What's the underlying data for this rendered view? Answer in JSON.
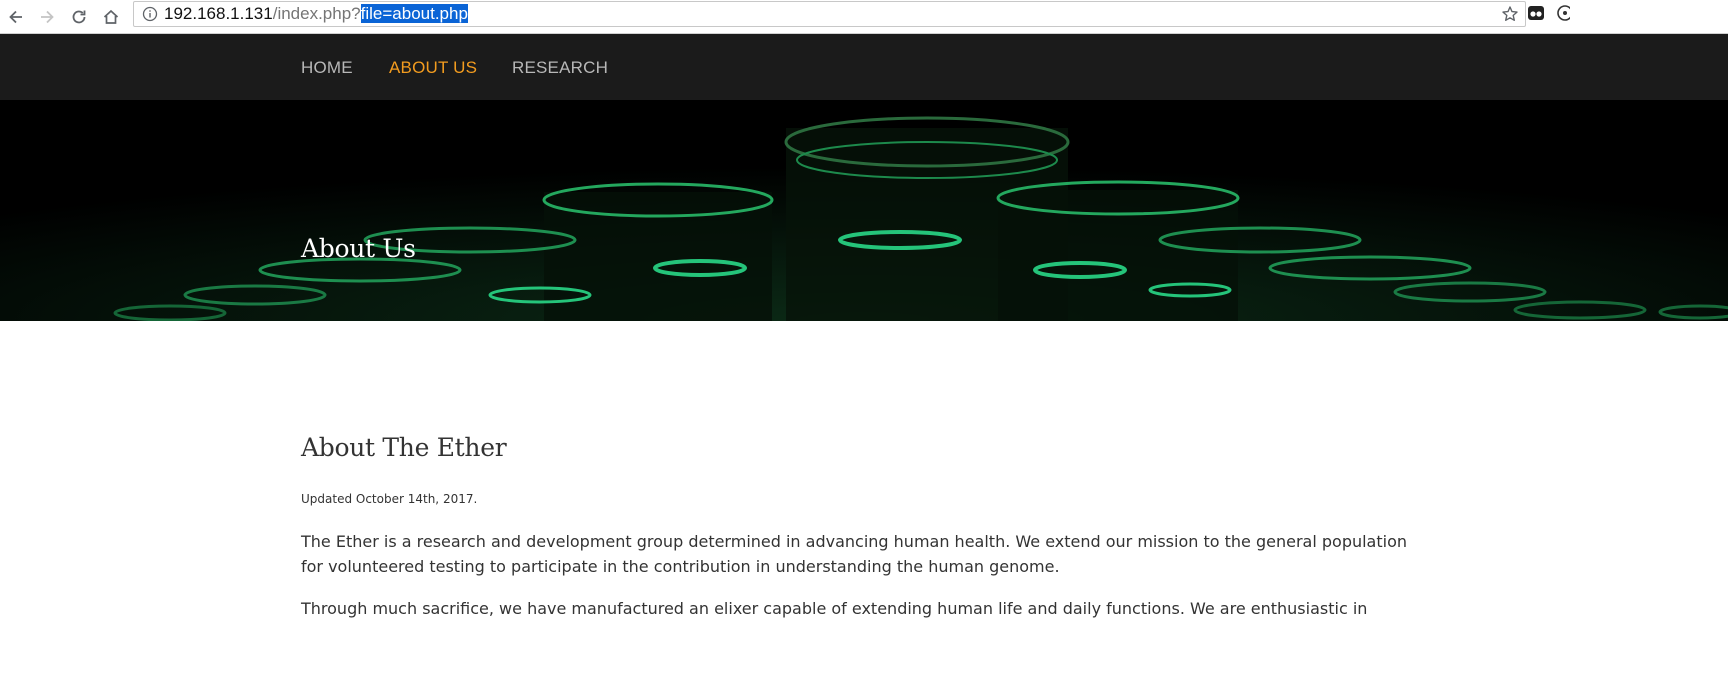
{
  "browser": {
    "url_host": "192.168.1.131",
    "url_path": "/index.php?",
    "url_query_selected": "file=about.php"
  },
  "nav": {
    "items": [
      {
        "label": "HOME"
      },
      {
        "label": "ABOUT US"
      },
      {
        "label": "RESEARCH"
      }
    ],
    "active_color": "#f39c1f"
  },
  "hero": {
    "title": "About Us"
  },
  "content": {
    "title": "About The Ether",
    "updated": "Updated October 14th, 2017.",
    "paragraphs": [
      "The Ether is a research and development group determined in advancing human health. We extend our mission to the general population for volunteered testing to participate in the contribution in understanding the human genome.",
      "Through much sacrifice, we have manufactured an elixer capable of extending human life and daily functions. We are enthusiastic in"
    ]
  }
}
